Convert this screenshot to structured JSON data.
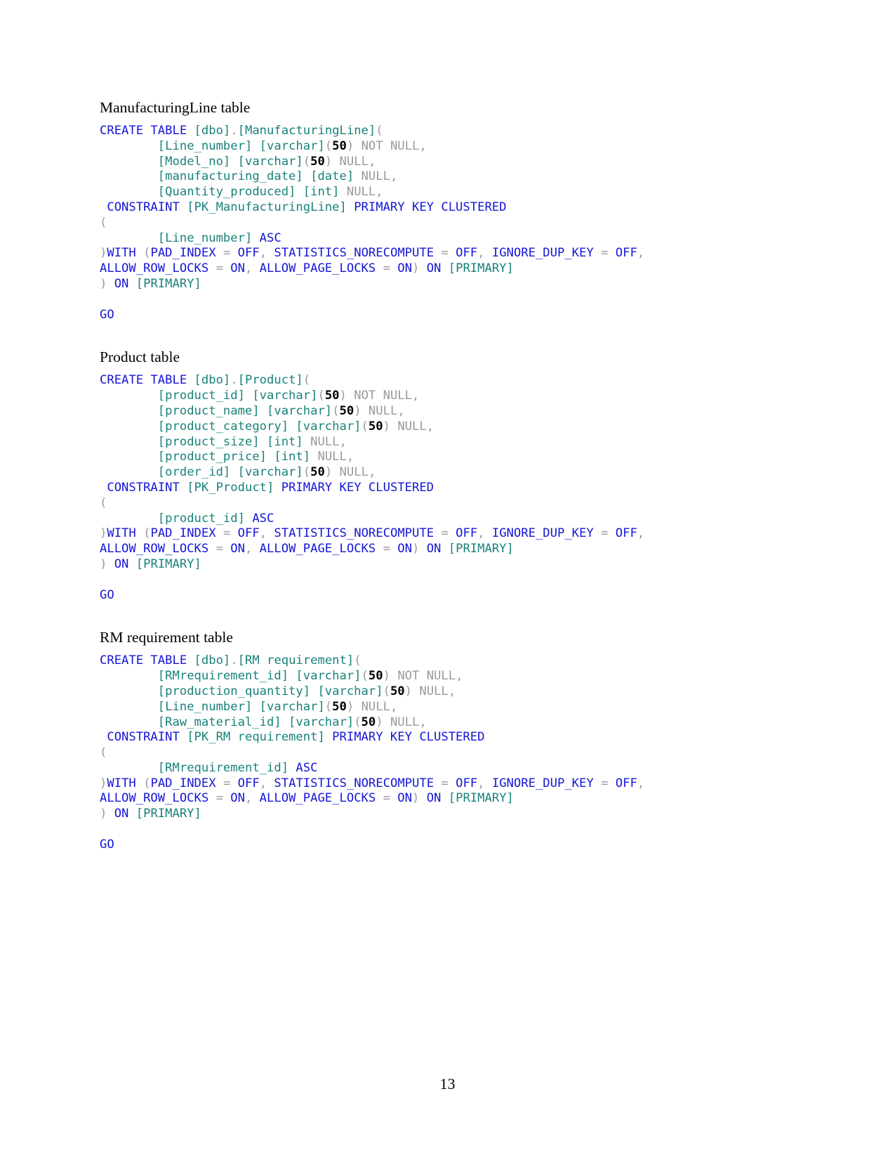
{
  "document": {
    "page_number": "13",
    "colors": {
      "keyword": "#1616d6",
      "identifier": "#18827a",
      "punctuation": "#9a9a9a",
      "null_literal": "#9a9a9a",
      "number": "#000000",
      "heading": "#000000",
      "background": "#ffffff"
    }
  },
  "sections": [
    {
      "heading": "ManufacturingLine table",
      "code_lines": [
        [
          {
            "t": "CREATE TABLE ",
            "c": "kw"
          },
          {
            "t": "[dbo]",
            "c": "ident"
          },
          {
            "t": ".",
            "c": "punc"
          },
          {
            "t": "[ManufacturingLine]",
            "c": "ident"
          },
          {
            "t": "(",
            "c": "punc"
          }
        ],
        [
          {
            "t": "\t",
            "c": "punc"
          },
          {
            "t": "[Line_number] [varchar]",
            "c": "ident"
          },
          {
            "t": "(",
            "c": "punc"
          },
          {
            "t": "50",
            "c": "num"
          },
          {
            "t": ") ",
            "c": "punc"
          },
          {
            "t": "NOT NULL",
            "c": "nulls"
          },
          {
            "t": ",",
            "c": "punc"
          }
        ],
        [
          {
            "t": "\t",
            "c": "punc"
          },
          {
            "t": "[Model_no] [varchar]",
            "c": "ident"
          },
          {
            "t": "(",
            "c": "punc"
          },
          {
            "t": "50",
            "c": "num"
          },
          {
            "t": ") ",
            "c": "punc"
          },
          {
            "t": "NULL",
            "c": "nulls"
          },
          {
            "t": ",",
            "c": "punc"
          }
        ],
        [
          {
            "t": "\t",
            "c": "punc"
          },
          {
            "t": "[manufacturing_date] [date] ",
            "c": "ident"
          },
          {
            "t": "NULL",
            "c": "nulls"
          },
          {
            "t": ",",
            "c": "punc"
          }
        ],
        [
          {
            "t": "\t",
            "c": "punc"
          },
          {
            "t": "[Quantity_produced] [int] ",
            "c": "ident"
          },
          {
            "t": "NULL",
            "c": "nulls"
          },
          {
            "t": ",",
            "c": "punc"
          }
        ],
        [
          {
            "t": " CONSTRAINT ",
            "c": "kw"
          },
          {
            "t": "[PK_ManufacturingLine]",
            "c": "ident"
          },
          {
            "t": " PRIMARY KEY CLUSTERED",
            "c": "kw"
          }
        ],
        [
          {
            "t": "(",
            "c": "punc"
          }
        ],
        [
          {
            "t": "\t",
            "c": "punc"
          },
          {
            "t": "[Line_number]",
            "c": "ident"
          },
          {
            "t": " ASC",
            "c": "kw"
          }
        ],
        [
          {
            "t": ")",
            "c": "punc"
          },
          {
            "t": "WITH ",
            "c": "kw"
          },
          {
            "t": "(",
            "c": "punc"
          },
          {
            "t": "PAD_INDEX",
            "c": "kw"
          },
          {
            "t": " = ",
            "c": "punc"
          },
          {
            "t": "OFF",
            "c": "kw"
          },
          {
            "t": ", ",
            "c": "punc"
          },
          {
            "t": "STATISTICS_NORECOMPUTE",
            "c": "kw"
          },
          {
            "t": " = ",
            "c": "punc"
          },
          {
            "t": "OFF",
            "c": "kw"
          },
          {
            "t": ", ",
            "c": "punc"
          },
          {
            "t": "IGNORE_DUP_KEY",
            "c": "kw"
          },
          {
            "t": " = ",
            "c": "punc"
          },
          {
            "t": "OFF",
            "c": "kw"
          },
          {
            "t": ",",
            "c": "punc"
          }
        ],
        [
          {
            "t": "ALLOW_ROW_LOCKS",
            "c": "kw"
          },
          {
            "t": " = ",
            "c": "punc"
          },
          {
            "t": "ON",
            "c": "kw"
          },
          {
            "t": ", ",
            "c": "punc"
          },
          {
            "t": "ALLOW_PAGE_LOCKS",
            "c": "kw"
          },
          {
            "t": " = ",
            "c": "punc"
          },
          {
            "t": "ON",
            "c": "kw"
          },
          {
            "t": ") ",
            "c": "punc"
          },
          {
            "t": "ON ",
            "c": "kw"
          },
          {
            "t": "[PRIMARY]",
            "c": "ident"
          }
        ],
        [
          {
            "t": ") ",
            "c": "punc"
          },
          {
            "t": "ON ",
            "c": "kw"
          },
          {
            "t": "[PRIMARY]",
            "c": "ident"
          }
        ],
        [],
        [
          {
            "t": "GO",
            "c": "go"
          }
        ]
      ]
    },
    {
      "heading": "Product table",
      "code_lines": [
        [
          {
            "t": "CREATE TABLE ",
            "c": "kw"
          },
          {
            "t": "[dbo]",
            "c": "ident"
          },
          {
            "t": ".",
            "c": "punc"
          },
          {
            "t": "[Product]",
            "c": "ident"
          },
          {
            "t": "(",
            "c": "punc"
          }
        ],
        [
          {
            "t": "\t",
            "c": "punc"
          },
          {
            "t": "[product_id] [varchar]",
            "c": "ident"
          },
          {
            "t": "(",
            "c": "punc"
          },
          {
            "t": "50",
            "c": "num"
          },
          {
            "t": ") ",
            "c": "punc"
          },
          {
            "t": "NOT NULL",
            "c": "nulls"
          },
          {
            "t": ",",
            "c": "punc"
          }
        ],
        [
          {
            "t": "\t",
            "c": "punc"
          },
          {
            "t": "[product_name] [varchar]",
            "c": "ident"
          },
          {
            "t": "(",
            "c": "punc"
          },
          {
            "t": "50",
            "c": "num"
          },
          {
            "t": ") ",
            "c": "punc"
          },
          {
            "t": "NULL",
            "c": "nulls"
          },
          {
            "t": ",",
            "c": "punc"
          }
        ],
        [
          {
            "t": "\t",
            "c": "punc"
          },
          {
            "t": "[product_category] [varchar]",
            "c": "ident"
          },
          {
            "t": "(",
            "c": "punc"
          },
          {
            "t": "50",
            "c": "num"
          },
          {
            "t": ") ",
            "c": "punc"
          },
          {
            "t": "NULL",
            "c": "nulls"
          },
          {
            "t": ",",
            "c": "punc"
          }
        ],
        [
          {
            "t": "\t",
            "c": "punc"
          },
          {
            "t": "[product_size] [int] ",
            "c": "ident"
          },
          {
            "t": "NULL",
            "c": "nulls"
          },
          {
            "t": ",",
            "c": "punc"
          }
        ],
        [
          {
            "t": "\t",
            "c": "punc"
          },
          {
            "t": "[product_price] [int] ",
            "c": "ident"
          },
          {
            "t": "NULL",
            "c": "nulls"
          },
          {
            "t": ",",
            "c": "punc"
          }
        ],
        [
          {
            "t": "\t",
            "c": "punc"
          },
          {
            "t": "[order_id] [varchar]",
            "c": "ident"
          },
          {
            "t": "(",
            "c": "punc"
          },
          {
            "t": "50",
            "c": "num"
          },
          {
            "t": ") ",
            "c": "punc"
          },
          {
            "t": "NULL",
            "c": "nulls"
          },
          {
            "t": ",",
            "c": "punc"
          }
        ],
        [
          {
            "t": " CONSTRAINT ",
            "c": "kw"
          },
          {
            "t": "[PK_Product]",
            "c": "ident"
          },
          {
            "t": " PRIMARY KEY CLUSTERED",
            "c": "kw"
          }
        ],
        [
          {
            "t": "(",
            "c": "punc"
          }
        ],
        [
          {
            "t": "\t",
            "c": "punc"
          },
          {
            "t": "[product_id]",
            "c": "ident"
          },
          {
            "t": " ASC",
            "c": "kw"
          }
        ],
        [
          {
            "t": ")",
            "c": "punc"
          },
          {
            "t": "WITH ",
            "c": "kw"
          },
          {
            "t": "(",
            "c": "punc"
          },
          {
            "t": "PAD_INDEX",
            "c": "kw"
          },
          {
            "t": " = ",
            "c": "punc"
          },
          {
            "t": "OFF",
            "c": "kw"
          },
          {
            "t": ", ",
            "c": "punc"
          },
          {
            "t": "STATISTICS_NORECOMPUTE",
            "c": "kw"
          },
          {
            "t": " = ",
            "c": "punc"
          },
          {
            "t": "OFF",
            "c": "kw"
          },
          {
            "t": ", ",
            "c": "punc"
          },
          {
            "t": "IGNORE_DUP_KEY",
            "c": "kw"
          },
          {
            "t": " = ",
            "c": "punc"
          },
          {
            "t": "OFF",
            "c": "kw"
          },
          {
            "t": ",",
            "c": "punc"
          }
        ],
        [
          {
            "t": "ALLOW_ROW_LOCKS",
            "c": "kw"
          },
          {
            "t": " = ",
            "c": "punc"
          },
          {
            "t": "ON",
            "c": "kw"
          },
          {
            "t": ", ",
            "c": "punc"
          },
          {
            "t": "ALLOW_PAGE_LOCKS",
            "c": "kw"
          },
          {
            "t": " = ",
            "c": "punc"
          },
          {
            "t": "ON",
            "c": "kw"
          },
          {
            "t": ") ",
            "c": "punc"
          },
          {
            "t": "ON ",
            "c": "kw"
          },
          {
            "t": "[PRIMARY]",
            "c": "ident"
          }
        ],
        [
          {
            "t": ") ",
            "c": "punc"
          },
          {
            "t": "ON ",
            "c": "kw"
          },
          {
            "t": "[PRIMARY]",
            "c": "ident"
          }
        ],
        [],
        [
          {
            "t": "GO",
            "c": "go"
          }
        ]
      ]
    },
    {
      "heading": "RM requirement table",
      "code_lines": [
        [
          {
            "t": "CREATE TABLE ",
            "c": "kw"
          },
          {
            "t": "[dbo]",
            "c": "ident"
          },
          {
            "t": ".",
            "c": "punc"
          },
          {
            "t": "[RM requirement]",
            "c": "ident"
          },
          {
            "t": "(",
            "c": "punc"
          }
        ],
        [
          {
            "t": "\t",
            "c": "punc"
          },
          {
            "t": "[RMrequirement_id] [varchar]",
            "c": "ident"
          },
          {
            "t": "(",
            "c": "punc"
          },
          {
            "t": "50",
            "c": "num"
          },
          {
            "t": ") ",
            "c": "punc"
          },
          {
            "t": "NOT NULL",
            "c": "nulls"
          },
          {
            "t": ",",
            "c": "punc"
          }
        ],
        [
          {
            "t": "\t",
            "c": "punc"
          },
          {
            "t": "[production_quantity] [varchar]",
            "c": "ident"
          },
          {
            "t": "(",
            "c": "punc"
          },
          {
            "t": "50",
            "c": "num"
          },
          {
            "t": ") ",
            "c": "punc"
          },
          {
            "t": "NULL",
            "c": "nulls"
          },
          {
            "t": ",",
            "c": "punc"
          }
        ],
        [
          {
            "t": "\t",
            "c": "punc"
          },
          {
            "t": "[Line_number] [varchar]",
            "c": "ident"
          },
          {
            "t": "(",
            "c": "punc"
          },
          {
            "t": "50",
            "c": "num"
          },
          {
            "t": ") ",
            "c": "punc"
          },
          {
            "t": "NULL",
            "c": "nulls"
          },
          {
            "t": ",",
            "c": "punc"
          }
        ],
        [
          {
            "t": "\t",
            "c": "punc"
          },
          {
            "t": "[Raw_material_id] [varchar]",
            "c": "ident"
          },
          {
            "t": "(",
            "c": "punc"
          },
          {
            "t": "50",
            "c": "num"
          },
          {
            "t": ") ",
            "c": "punc"
          },
          {
            "t": "NULL",
            "c": "nulls"
          },
          {
            "t": ",",
            "c": "punc"
          }
        ],
        [
          {
            "t": " CONSTRAINT ",
            "c": "kw"
          },
          {
            "t": "[PK_RM requirement]",
            "c": "ident"
          },
          {
            "t": " PRIMARY KEY CLUSTERED",
            "c": "kw"
          }
        ],
        [
          {
            "t": "(",
            "c": "punc"
          }
        ],
        [
          {
            "t": "\t",
            "c": "punc"
          },
          {
            "t": "[RMrequirement_id]",
            "c": "ident"
          },
          {
            "t": " ASC",
            "c": "kw"
          }
        ],
        [
          {
            "t": ")",
            "c": "punc"
          },
          {
            "t": "WITH ",
            "c": "kw"
          },
          {
            "t": "(",
            "c": "punc"
          },
          {
            "t": "PAD_INDEX",
            "c": "kw"
          },
          {
            "t": " = ",
            "c": "punc"
          },
          {
            "t": "OFF",
            "c": "kw"
          },
          {
            "t": ", ",
            "c": "punc"
          },
          {
            "t": "STATISTICS_NORECOMPUTE",
            "c": "kw"
          },
          {
            "t": " = ",
            "c": "punc"
          },
          {
            "t": "OFF",
            "c": "kw"
          },
          {
            "t": ", ",
            "c": "punc"
          },
          {
            "t": "IGNORE_DUP_KEY",
            "c": "kw"
          },
          {
            "t": " = ",
            "c": "punc"
          },
          {
            "t": "OFF",
            "c": "kw"
          },
          {
            "t": ",",
            "c": "punc"
          }
        ],
        [
          {
            "t": "ALLOW_ROW_LOCKS",
            "c": "kw"
          },
          {
            "t": " = ",
            "c": "punc"
          },
          {
            "t": "ON",
            "c": "kw"
          },
          {
            "t": ", ",
            "c": "punc"
          },
          {
            "t": "ALLOW_PAGE_LOCKS",
            "c": "kw"
          },
          {
            "t": " = ",
            "c": "punc"
          },
          {
            "t": "ON",
            "c": "kw"
          },
          {
            "t": ") ",
            "c": "punc"
          },
          {
            "t": "ON ",
            "c": "kw"
          },
          {
            "t": "[PRIMARY]",
            "c": "ident"
          }
        ],
        [
          {
            "t": ") ",
            "c": "punc"
          },
          {
            "t": "ON ",
            "c": "kw"
          },
          {
            "t": "[PRIMARY]",
            "c": "ident"
          }
        ],
        [],
        [
          {
            "t": "GO",
            "c": "go"
          }
        ]
      ]
    }
  ]
}
